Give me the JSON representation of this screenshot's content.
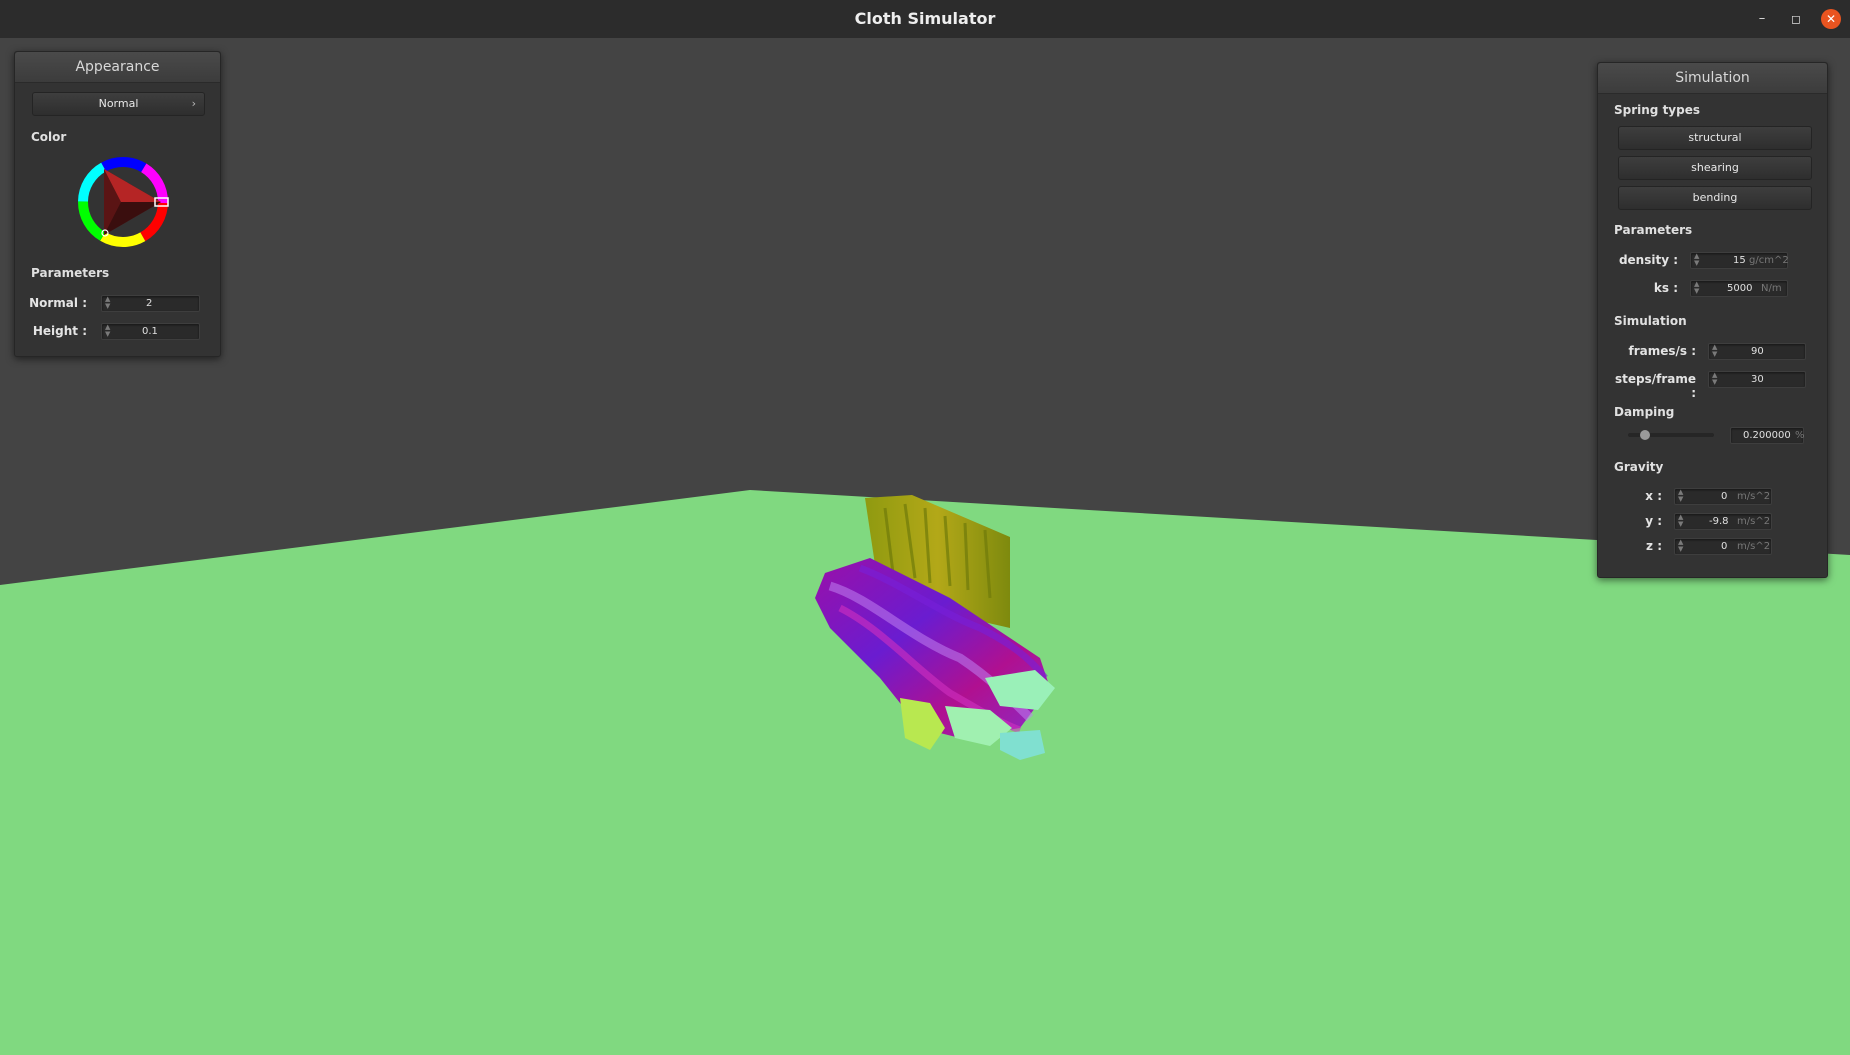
{
  "window": {
    "title": "Cloth Simulator",
    "controls": {
      "minimize": "–",
      "maximize": "◻",
      "close": "✕"
    }
  },
  "colors": {
    "sky": "#444444",
    "ground": "#80d980",
    "titlebar": "#2c2c2c",
    "panel": "#333333",
    "close_button": "#e95420"
  },
  "appearance": {
    "title": "Appearance",
    "mode_label": "Normal",
    "mode_arrow": "›",
    "color_label": "Color",
    "parameters_label": "Parameters",
    "normal": {
      "label": "Normal :",
      "value": "2"
    },
    "height": {
      "label": "Height :",
      "value": "0.1"
    }
  },
  "simulation": {
    "title": "Simulation",
    "spring_types_label": "Spring types",
    "spring_types": [
      "structural",
      "shearing",
      "bending"
    ],
    "parameters_label": "Parameters",
    "density": {
      "label": "density :",
      "value": "15",
      "unit": "g/cm^2"
    },
    "ks": {
      "label": "ks :",
      "value": "5000",
      "unit": "N/m"
    },
    "simulation_label": "Simulation",
    "frames": {
      "label": "frames/s :",
      "value": "90"
    },
    "steps": {
      "label": "steps/frame :",
      "value": "30"
    },
    "damping_label": "Damping",
    "damping": {
      "value": "0.200000",
      "unit": "%",
      "fraction": 0.2
    },
    "gravity_label": "Gravity",
    "gravity": [
      {
        "label": "x :",
        "value": "0",
        "unit": "m/s^2"
      },
      {
        "label": "y :",
        "value": "-9.8",
        "unit": "m/s^2"
      },
      {
        "label": "z :",
        "value": "0",
        "unit": "m/s^2"
      }
    ]
  }
}
